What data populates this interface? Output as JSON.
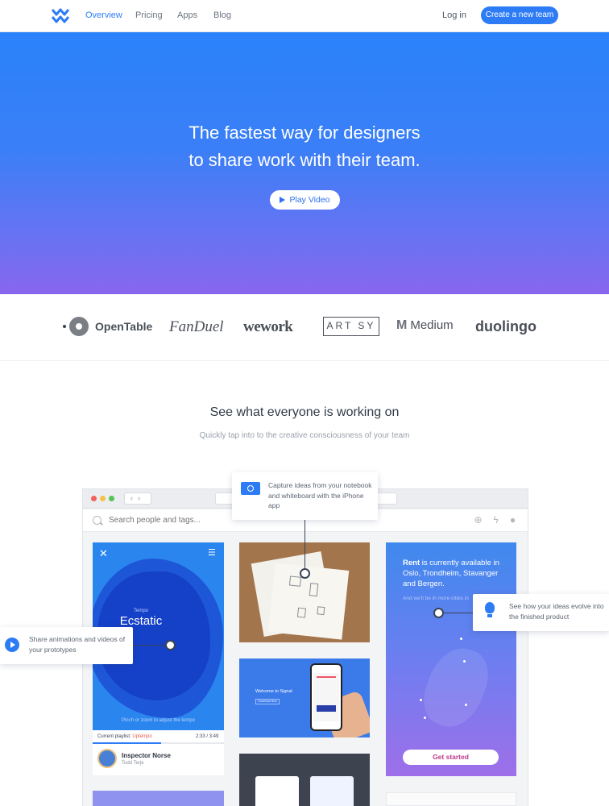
{
  "nav": {
    "links": [
      "Overview",
      "Pricing",
      "Apps",
      "Blog"
    ],
    "login": "Log in",
    "cta": "Create a new team",
    "colors": {
      "accent": "#2d7cf6"
    }
  },
  "hero": {
    "headline_line1": "The fastest way for designers",
    "headline_line2": "to share work with their team.",
    "play_label": "Play Video"
  },
  "logos": {
    "opentable": "OpenTable",
    "fanduel": "FanDuel",
    "wework": "wework",
    "artsy": "ART SY",
    "medium": "Medium",
    "duolingo": "duolingo"
  },
  "section": {
    "title": "See what everyone is working on",
    "subtitle": "Quickly tap into to the creative consciousness of your team"
  },
  "app": {
    "search_placeholder": "Search people and tags...",
    "tempo": {
      "label": "Tempo",
      "word": "Ecstatic",
      "hint": "Pinch or zoom to adjust the tempo",
      "playlist_prefix": "Current playlist:",
      "playlist_name": "Uptempo",
      "time": "2:33 / 3:49",
      "song": "Inspector Norse",
      "artist": "Todd Terje",
      "progress": 0.52
    },
    "signal": {
      "title": "Welcome to Signal",
      "button": "Download Now"
    },
    "rent": {
      "brand": "Rent",
      "text": "is currently available in Oslo, Trondheim, Stavanger and Bergen.",
      "sub": "And we'll be in more cities in",
      "button": "Get started"
    }
  },
  "callouts": {
    "capture": "Capture ideas from your notebook and whiteboard with the iPhone app",
    "share": "Share animations and videos of your prototypes",
    "evolve": "See how your ideas evolve into the finished product"
  }
}
